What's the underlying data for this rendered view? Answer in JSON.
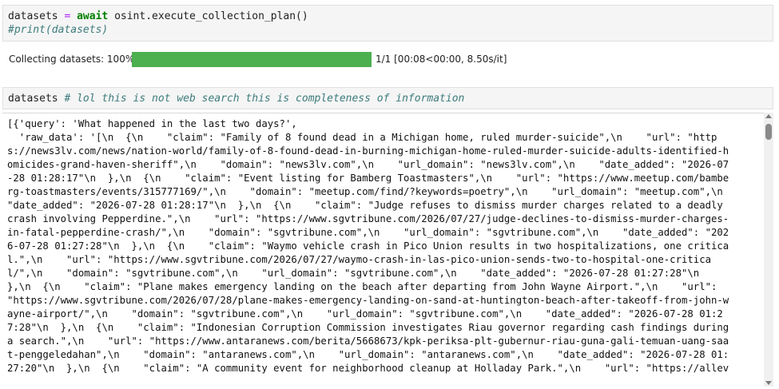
{
  "cell1": {
    "target": "datasets",
    "equals": "=",
    "keyword": "await",
    "call": " osint.execute_collection_plan()",
    "comment": "#print(datasets)"
  },
  "progress": {
    "label": "Collecting datasets: 100%",
    "percent": 100,
    "stats": "1/1 [00:08<00:00, 8.50s/it]",
    "fill_color": "#4caf50"
  },
  "cell2": {
    "target": "datasets",
    "comment": "# lol this is not web search this is completeness of information"
  },
  "output": {
    "lines": [
      "[{'query': 'What happened in the last two days?',",
      "  'raw_data': '[\\n  {\\n    \"claim\": \"Family of 8 found dead in a Michigan home, ruled murder-suicide\",\\n    \"url\": \"http",
      "s://news3lv.com/news/nation-world/family-of-8-found-dead-in-burning-michigan-home-ruled-murder-suicide-adults-identified-h",
      "omicides-grand-haven-sheriff\",\\n    \"domain\": \"news3lv.com\",\\n    \"url_domain\": \"news3lv.com\",\\n    \"date_added\": \"2026-07",
      "-28 01:28:17\"\\n  },\\n  {\\n    \"claim\": \"Event listing for Bamberg Toastmasters\",\\n    \"url\": \"https://www.meetup.com/bambe",
      "rg-toastmasters/events/315777169/\",\\n    \"domain\": \"meetup.com/find/?keywords=poetry\",\\n    \"url_domain\": \"meetup.com\",\\n",
      "\"date_added\": \"2026-07-28 01:28:17\"\\n  },\\n  {\\n    \"claim\": \"Judge refuses to dismiss murder charges related to a deadly",
      "crash involving Pepperdine.\",\\n    \"url\": \"https://www.sgvtribune.com/2026/07/27/judge-declines-to-dismiss-murder-charges-",
      "in-fatal-pepperdine-crash/\",\\n    \"domain\": \"sgvtribune.com\",\\n    \"url_domain\": \"sgvtribune.com\",\\n    \"date_added\": \"202",
      "6-07-28 01:27:28\"\\n  },\\n  {\\n    \"claim\": \"Waymo vehicle crash in Pico Union results in two hospitalizations, one critica",
      "l.\",\\n    \"url\": \"https://www.sgvtribune.com/2026/07/27/waymo-crash-in-las-pico-union-sends-two-to-hospital-one-critica",
      "l/\",\\n    \"domain\": \"sgvtribune.com\",\\n    \"url_domain\": \"sgvtribune.com\",\\n    \"date_added\": \"2026-07-28 01:27:28\"\\n",
      "},\\n  {\\n    \"claim\": \"Plane makes emergency landing on the beach after departing from John Wayne Airport.\",\\n    \"url\":",
      "\"https://www.sgvtribune.com/2026/07/28/plane-makes-emergency-landing-on-sand-at-huntington-beach-after-takeoff-from-john-w",
      "ayne-airport/\",\\n    \"domain\": \"sgvtribune.com\",\\n    \"url_domain\": \"sgvtribune.com\",\\n    \"date_added\": \"2026-07-28 01:2",
      "7:28\"\\n  },\\n  {\\n    \"claim\": \"Indonesian Corruption Commission investigates Riau governor regarding cash findings during",
      "a search.\",\\n    \"url\": \"https://www.antaranews.com/berita/5668673/kpk-periksa-plt-gubernur-riau-guna-gali-temuan-uang-saa",
      "t-penggeledahan\",\\n    \"domain\": \"antaranews.com\",\\n    \"url_domain\": \"antaranews.com\",\\n    \"date_added\": \"2026-07-28 01:",
      "27:20\"\\n  },\\n  {\\n    \"claim\": \"A community event for neighborhood cleanup at Holladay Park.\",\\n    \"url\": \"https://allev"
    ]
  }
}
